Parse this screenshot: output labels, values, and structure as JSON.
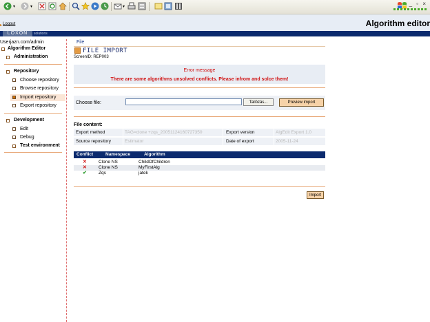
{
  "app": {
    "logout": "Logout",
    "title": "Algorithm editor",
    "logo": "LOXON",
    "logo_sub": "solutions",
    "userid": "Userjazn.com/admin"
  },
  "sidebar": {
    "algorithm_editor": "Algorithm Editor",
    "administration": "Administration",
    "repository": "Repository",
    "repo_items": [
      "Choose repository",
      "Browse repository",
      "Import repository",
      "Export repository"
    ],
    "development": "Development",
    "dev_items": [
      "Edit",
      "Debug",
      "Test environment"
    ]
  },
  "main": {
    "file_link": "File",
    "page_title": "FILE IMPORT",
    "screen_id": "ScreenID: REP003",
    "error_title": "Error message",
    "error_msg": "There are some algorithms unsolved conflicts. Please infrom and solce them!",
    "choose_label": "Choose file:",
    "file_value": "",
    "browse_label": "Tallózás...",
    "preview_label": "Preview import",
    "file_content_label": "File content:",
    "info": {
      "export_method_label": "Export method",
      "export_method_value": "TAG=clone +zqs_20051124160727350",
      "export_version_label": "Export version",
      "export_version_value": "AlgEdit Export 1.0",
      "source_repo_label": "Source repository",
      "source_repo_value": "Estimator",
      "date_label": "Date of export",
      "date_value": "2005-11-24"
    },
    "table": {
      "headers": [
        "Conflict",
        "Namespace",
        "Algorithm"
      ],
      "rows": [
        {
          "conflict": "x",
          "namespace": "Clone NS",
          "algorithm": "ChildOfChildren"
        },
        {
          "conflict": "x",
          "namespace": "Clone NS",
          "algorithm": "MyFirstAlg"
        },
        {
          "conflict": "ok",
          "namespace": "Zqs",
          "algorithm": "jatek"
        }
      ]
    },
    "import_label": "Import"
  },
  "colors": {
    "brand": "#0b2a6e",
    "accent": "#e39a42",
    "error": "#d01010"
  }
}
